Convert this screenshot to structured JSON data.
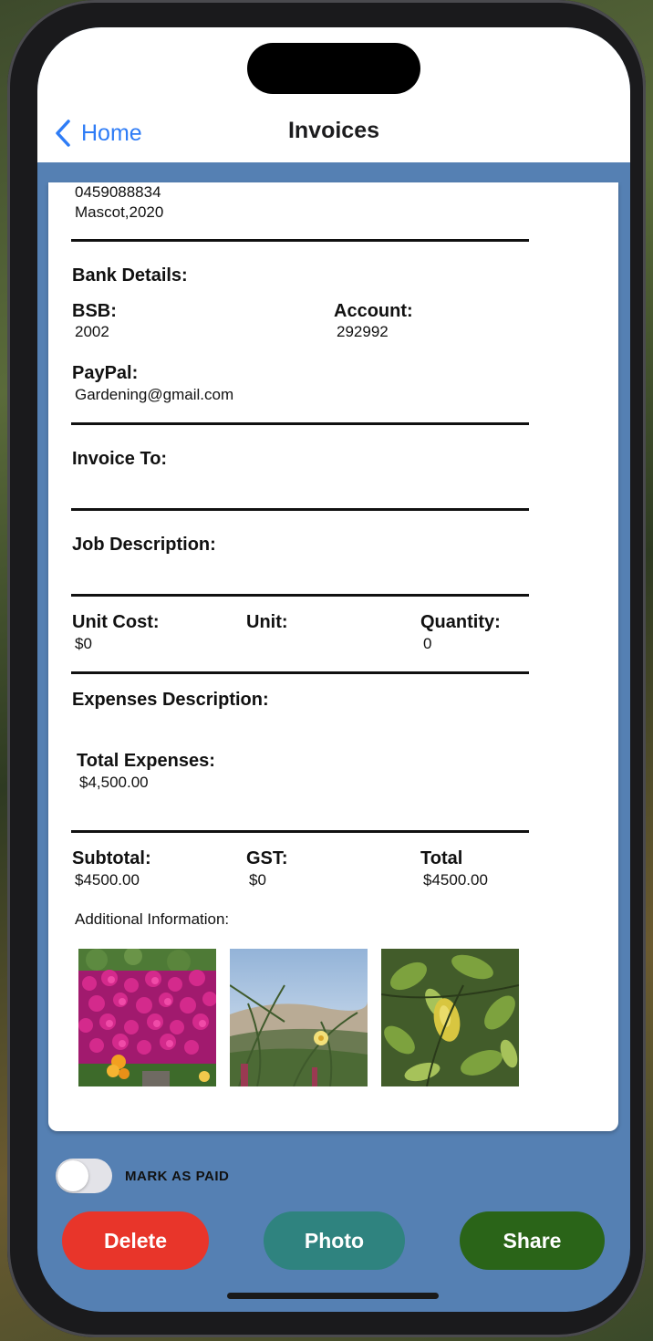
{
  "nav": {
    "back_label": "Home",
    "title": "Invoices"
  },
  "business": {
    "phone": "0459088834",
    "location": "Mascot,2020"
  },
  "bank": {
    "heading": "Bank Details:",
    "bsb_label": "BSB:",
    "bsb_value": "2002",
    "account_label": "Account:",
    "account_value": "292992",
    "paypal_label": "PayPal:",
    "paypal_value": "Gardening@gmail.com"
  },
  "invoice_to": {
    "label": "Invoice To:"
  },
  "job": {
    "label": "Job Description:"
  },
  "units": {
    "unit_cost_label": "Unit Cost:",
    "unit_cost_value": "$0",
    "unit_label": "Unit:",
    "quantity_label": "Quantity:",
    "quantity_value": "0"
  },
  "expenses": {
    "label": "Expenses Description:",
    "total_label": "Total Expenses:",
    "total_value": "$4,500.00"
  },
  "totals": {
    "subtotal_label": "Subtotal:",
    "subtotal_value": "$4500.00",
    "gst_label": "GST:",
    "gst_value": "$0",
    "total_label": "Total",
    "total_value": "$4500.00"
  },
  "additional": {
    "label": "Additional Information:"
  },
  "photos": [
    "pink-flowers-photo",
    "grass-dune-photo",
    "citrus-leaves-photo"
  ],
  "paid": {
    "label": "MARK AS PAID",
    "on": false
  },
  "actions": {
    "delete_label": "Delete",
    "delete_color": "#e8352a",
    "photo_label": "Photo",
    "photo_color": "#2f837f",
    "share_label": "Share",
    "share_color": "#2a6418"
  },
  "colors": {
    "background": "#5580b3",
    "accent": "#2e7cf6"
  }
}
